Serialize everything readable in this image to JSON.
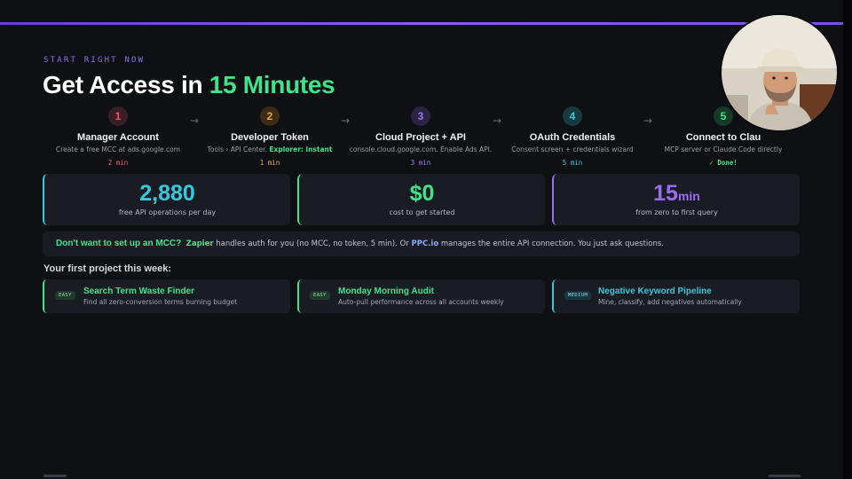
{
  "slide": {
    "eyebrow": "START RIGHT NOW",
    "headline_main": "Get Access in ",
    "headline_accent": "15 Minutes"
  },
  "steps": [
    {
      "number": "1",
      "title": "Manager Account",
      "desc": "Create a free MCC at ads.google.com",
      "desc_highlight": "",
      "time": "2 min",
      "color": "#f0566a"
    },
    {
      "number": "2",
      "title": "Developer Token",
      "desc": "Tools › API Center. ",
      "desc_highlight": "Explorer: instant",
      "time": "1 min",
      "color": "#f0a53a"
    },
    {
      "number": "3",
      "title": "Cloud Project + API",
      "desc": "console.cloud.google.com. Enable Ads API.",
      "desc_highlight": "",
      "time": "3 min",
      "color": "#9b7cf4"
    },
    {
      "number": "4",
      "title": "OAuth Credentials",
      "desc": "Consent screen + credentials wizard",
      "desc_highlight": "",
      "time": "5 min",
      "color": "#35c9dc"
    },
    {
      "number": "5",
      "title": "Connect to Clau",
      "desc": "MCP server or Claude Code directly",
      "desc_highlight": "",
      "time": "✓ Done!",
      "color": "#3ee38a"
    }
  ],
  "stats": [
    {
      "value": "2,880",
      "unit": "",
      "label": "free API operations per day",
      "color": "#35c9dc"
    },
    {
      "value": "$0",
      "unit": "",
      "label": "cost to get started",
      "color": "#3ee38a"
    },
    {
      "value": "15",
      "unit": "min",
      "label": "from zero to first query",
      "color": "#9b6cf6"
    }
  ],
  "banner": {
    "question": "Don't want to set up an MCC?",
    "zapier": "Zapier",
    "mid": " handles auth for you (no MCC, no token, 5 min). Or ",
    "ppc": "PPC.io",
    "tail": " manages the entire API connection. You just ask questions."
  },
  "projects_title": "Your first project this week:",
  "projects": [
    {
      "badge": "EASY",
      "title": "Search Term Waste Finder",
      "desc": "Find all zero-conversion terms burning budget",
      "color": "#3ee38a"
    },
    {
      "badge": "EASY",
      "title": "Monday Morning Audit",
      "desc": "Auto-pull performance across all accounts weekly",
      "color": "#3ee38a"
    },
    {
      "badge": "MEDIUM",
      "title": "Negative Keyword Pipeline",
      "desc": "Mine, classify, add negatives automatically",
      "color": "#35c9dc"
    }
  ],
  "colors": {
    "background": "#0f1014",
    "card": "#1a1c23",
    "accent_purple": "#8d6ef0",
    "accent_green": "#3ee38a"
  }
}
